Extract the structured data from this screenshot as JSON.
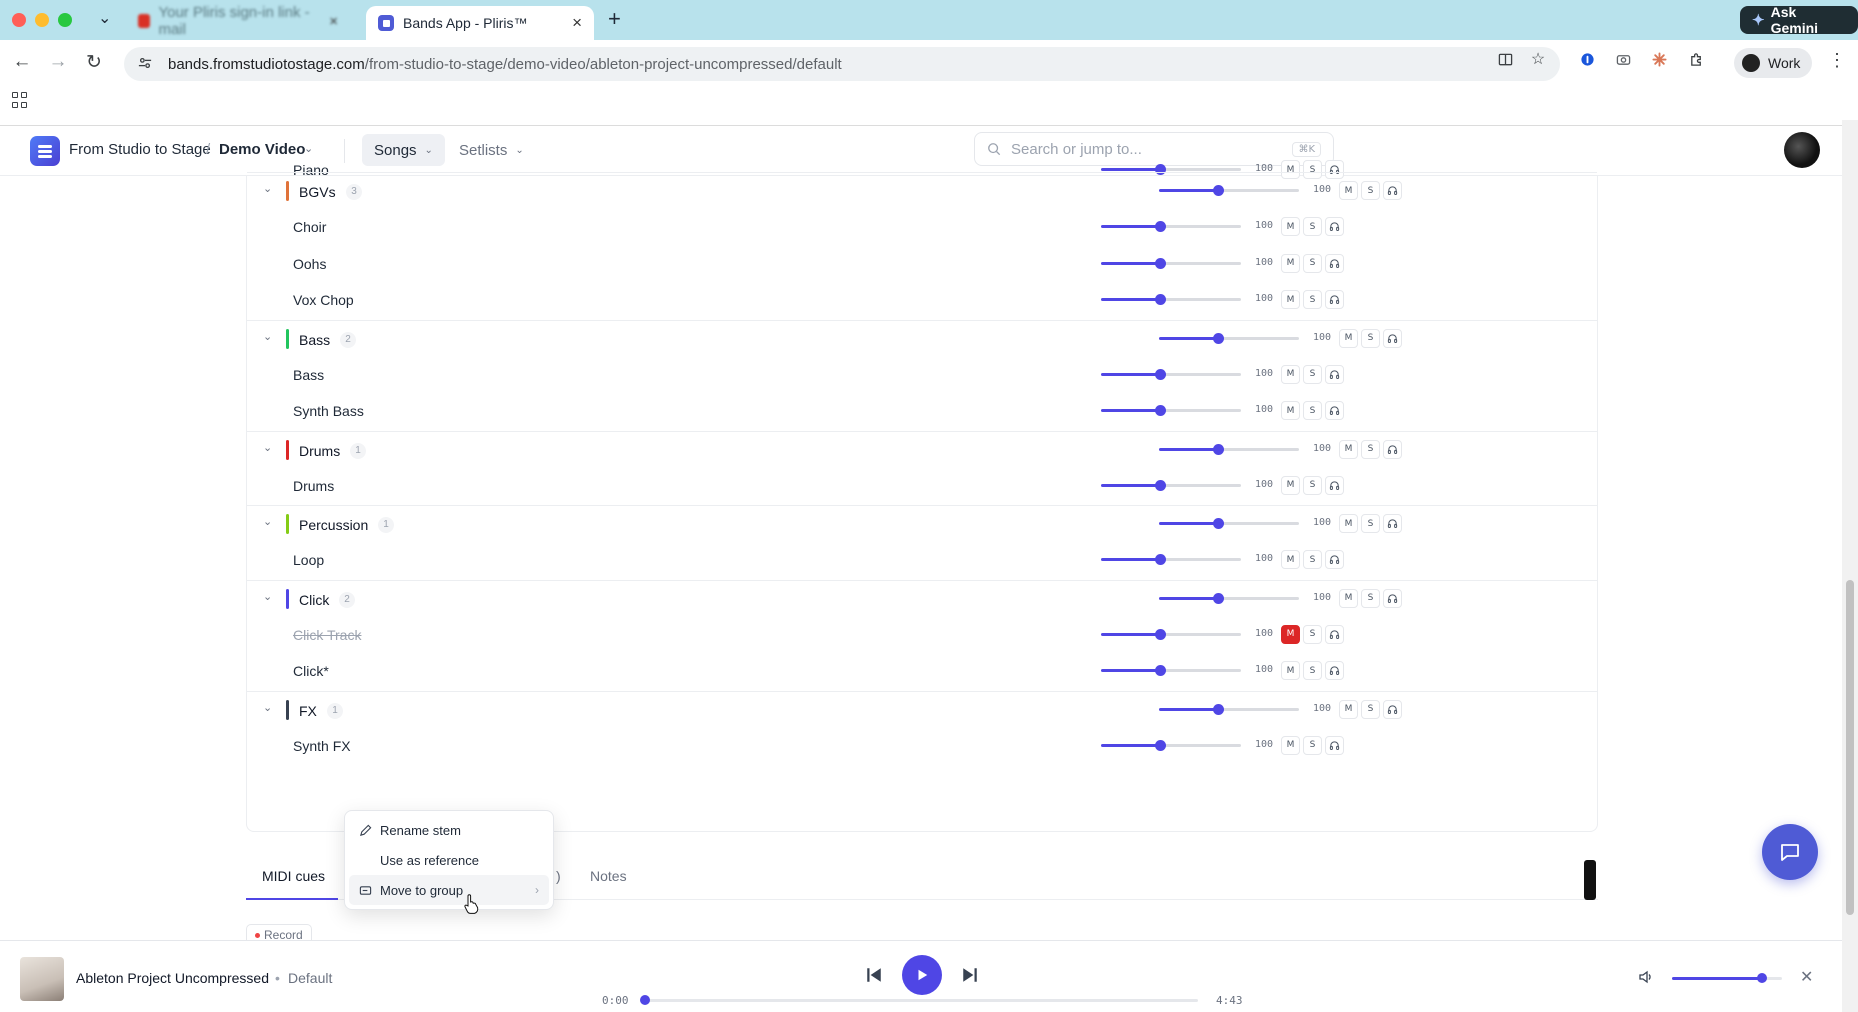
{
  "browser": {
    "inactive_tab_title": "Your Pliris sign-in link - mail",
    "active_tab_title": "Bands App - Pliris™",
    "url_domain": "bands.fromstudiotostage.com",
    "url_path": "/from-studio-to-stage/demo-video/ableton-project-uncompressed/default",
    "gemini_label": "Ask Gemini",
    "profile_label": "Work"
  },
  "header": {
    "org": "From Studio to Stage",
    "separator": "/",
    "project": "Demo Video",
    "songs_label": "Songs",
    "setlists_label": "Setlists",
    "search_placeholder": "Search or jump to...",
    "search_shortcut": "⌘K"
  },
  "mixer": {
    "partial_stem": {
      "name": "Piano",
      "volume": "100"
    },
    "groups": [
      {
        "name": "BGVs",
        "count": "3",
        "color": "#e0733a",
        "volume": "100",
        "stems": [
          {
            "name": "Choir",
            "volume": "100"
          },
          {
            "name": "Oohs",
            "volume": "100"
          },
          {
            "name": "Vox Chop",
            "volume": "100"
          }
        ]
      },
      {
        "name": "Bass",
        "count": "2",
        "color": "#22c55e",
        "volume": "100",
        "stems": [
          {
            "name": "Bass",
            "volume": "100"
          },
          {
            "name": "Synth Bass",
            "volume": "100"
          }
        ]
      },
      {
        "name": "Drums",
        "count": "1",
        "color": "#dc2626",
        "volume": "100",
        "stems": [
          {
            "name": "Drums",
            "volume": "100"
          }
        ]
      },
      {
        "name": "Percussion",
        "count": "1",
        "color": "#84cc16",
        "volume": "100",
        "stems": [
          {
            "name": "Loop",
            "volume": "100"
          }
        ]
      },
      {
        "name": "Click",
        "count": "2",
        "color": "#4f46e5",
        "volume": "100",
        "stems": [
          {
            "name": "Click Track",
            "volume": "100",
            "muted": true
          },
          {
            "name": "Click*",
            "volume": "100"
          }
        ]
      },
      {
        "name": "FX",
        "count": "1",
        "color": "#374151",
        "volume": "100",
        "stems": [
          {
            "name": "Synth FX",
            "volume": "100"
          }
        ]
      }
    ],
    "mute_label": "M",
    "solo_label": "S"
  },
  "context_menu": {
    "rename": "Rename stem",
    "reference": "Use as reference",
    "move": "Move to group"
  },
  "bottom_tabs": {
    "midi": "MIDI cues",
    "hidden_fragment": ")",
    "notes": "Notes",
    "record": "Record"
  },
  "player": {
    "song": "Ableton Project Uncompressed",
    "dot": "•",
    "version": "Default",
    "elapsed": "0:00",
    "duration": "4:43",
    "progress": 0,
    "volume_fraction": 0.82
  },
  "icons": [
    "chevron-down-icon",
    "headphones-icon",
    "pencil-icon",
    "group-icon",
    "play-icon",
    "skip-back-icon",
    "skip-forward-icon",
    "speaker-icon",
    "chat-icon"
  ]
}
